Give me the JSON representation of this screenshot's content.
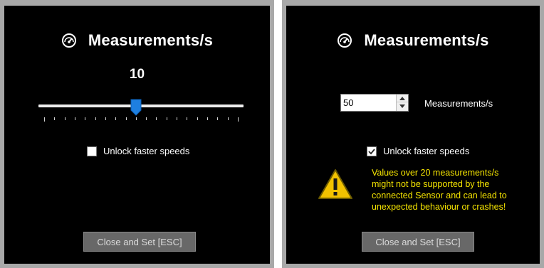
{
  "left_dialog": {
    "title": "Measurements/s",
    "icon": "speedometer-icon",
    "slider": {
      "value_label": "10",
      "value": 10,
      "min": 1,
      "max": 20,
      "tick_count": 20,
      "thumb_color": "#1e7fe0"
    },
    "unlock_checkbox": {
      "label": "Unlock faster speeds",
      "checked": false
    },
    "close_button": "Close and Set [ESC]"
  },
  "right_dialog": {
    "title": "Measurements/s",
    "icon": "speedometer-icon",
    "number_input": {
      "value": "50"
    },
    "unit_label": "Measurements/s",
    "unlock_checkbox": {
      "label": "Unlock faster speeds",
      "checked": true
    },
    "warning": {
      "icon": "warning-triangle-icon",
      "lines": [
        "Values over 20 measurements/s",
        "might not be supported by the",
        "connected Sensor and can lead to",
        "unexpected behaviour or crashes!"
      ],
      "color": "#f5e400"
    },
    "close_button": "Close and Set [ESC]"
  }
}
